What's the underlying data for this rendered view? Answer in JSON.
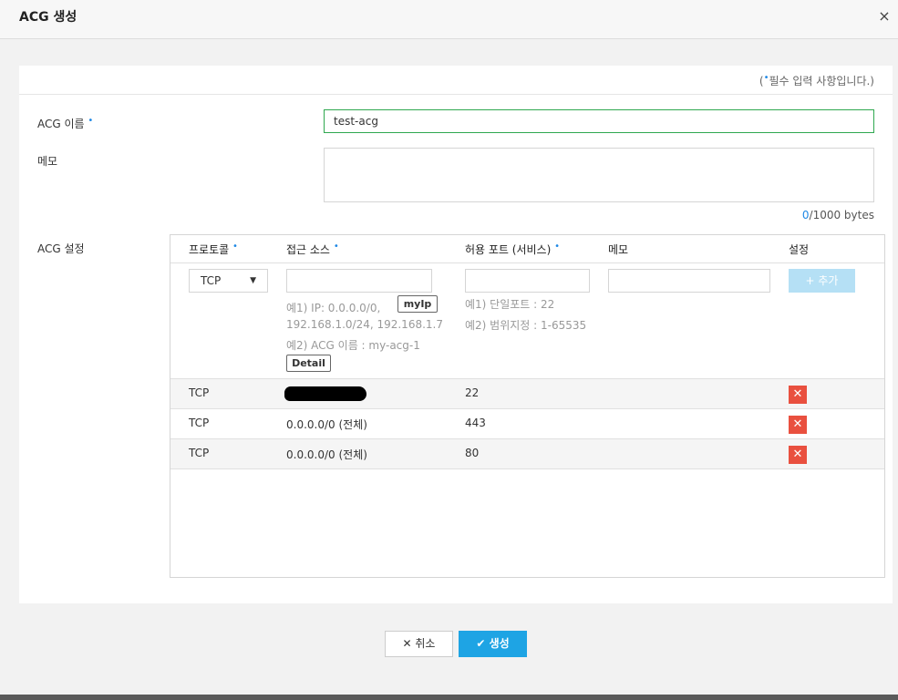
{
  "dialog": {
    "title": "ACG 생성",
    "close_icon": "×"
  },
  "form": {
    "required_note_prefix": "(",
    "required_note_dot": "•",
    "required_note_text": "필수 입력 사항입니다.)",
    "name_label": "ACG 이름",
    "name_value": "test-acg",
    "memo_label": "메모",
    "byte_current": "0",
    "byte_max": "/1000 bytes",
    "acg_label": "ACG 설정"
  },
  "table": {
    "headers": {
      "protocol": "프로토콜",
      "source": "접근 소스",
      "port": "허용 포트 (서비스)",
      "memo": "메모",
      "settings": "설정"
    },
    "add_row": {
      "protocol_selected": "TCP",
      "myip_label": "myIp",
      "detail_label": "Detail",
      "add_label": "+ 추가",
      "source_hint1": "예1) IP: 0.0.0.0/0,",
      "source_hint2": "192.168.1.0/24, 192.168.1.7",
      "source_hint3": "예2) ACG 이름 : my-acg-1",
      "port_hint1": "예1) 단일포트 : 22",
      "port_hint2": "예2) 범위지정 : 1-65535"
    },
    "rows": [
      {
        "protocol": "TCP",
        "source": "",
        "port": "22"
      },
      {
        "protocol": "TCP",
        "source": "0.0.0.0/0 (전체)",
        "port": "443"
      },
      {
        "protocol": "TCP",
        "source": "0.0.0.0/0 (전체)",
        "port": "80"
      }
    ],
    "delete_icon": "✕"
  },
  "footer": {
    "cancel_label": "취소",
    "cancel_icon": "✕",
    "create_label": "생성",
    "create_icon": "✔"
  },
  "colors": {
    "accent": "#1ea4e4",
    "delete": "#e9503f",
    "valid_border": "#2fa84f",
    "required_dot": "#1e88e5"
  }
}
